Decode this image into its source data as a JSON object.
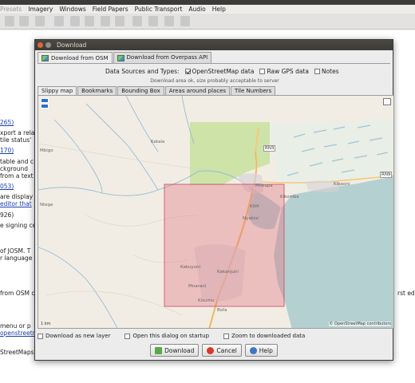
{
  "background": {
    "menu": [
      "Presets",
      "Imagery",
      "Windows",
      "Field Papers",
      "Public Transport",
      "Audio",
      "Help"
    ],
    "lines": [
      {
        "text": "265)",
        "link": true
      },
      {
        "text": "xport a rela",
        "link": false
      },
      {
        "text": " tile status'",
        "link": false
      },
      {
        "text": "170)",
        "link": true
      },
      {
        "text": "table and c",
        "link": false
      },
      {
        "text": "ckground",
        "link": false
      },
      {
        "text": "from a text",
        "link": false
      },
      {
        "text": "053)",
        "link": true
      },
      {
        "text": " are display",
        "link": false
      },
      {
        "text": "editor that",
        "link": true
      },
      {
        "text": "926)",
        "link": false
      },
      {
        "text": "e signing ce",
        "link": false
      },
      {
        "text": " of JOSM. T",
        "link": false
      },
      {
        "text": "r language",
        "link": false
      },
      {
        "text": "from OSM c",
        "link": false
      },
      {
        "text": " menu or p",
        "link": false
      },
      {
        "text": "openstreetr",
        "link": true
      },
      {
        "text": "StreetMaps",
        "link": false
      }
    ],
    "right_text": "rst edi"
  },
  "dialog": {
    "title": "Download",
    "source_tabs": [
      "Download from OSM",
      "Download from Overpass API"
    ],
    "data_sources_label": "Data Sources and Types:",
    "data_sources": [
      {
        "label": "OpenStreetMap data",
        "checked": true
      },
      {
        "label": "Raw GPS data",
        "checked": false
      },
      {
        "label": "Notes",
        "checked": false
      }
    ],
    "area_hint": "Download area ok, size probably acceptable to server",
    "area_tabs": [
      "Slippy map",
      "Bookmarks",
      "Bounding Box",
      "Areas around places",
      "Tile Numbers"
    ],
    "map": {
      "labels": {
        "mbigo": "Mbigo",
        "katala": "Katala",
        "rn3": "RN3",
        "rn9": "RN9",
        "mtwapa": "Mtwapa",
        "ntege": "Ntege",
        "kilifi": "Kilifi",
        "nyakisi": "Nyakisi",
        "kikombe": "Kikombe",
        "kibaoni": "Kibaoni",
        "kakuyuni": "Kakuyuni",
        "kakanjuni": "Kakanjuni",
        "mnarani": "Mnarani",
        "kisumu": "Kisumu",
        "bofa": "Bofa"
      },
      "attribution": "© OpenStreetMap contributors",
      "scale": "1 km"
    },
    "options": [
      {
        "label": "Download as new layer",
        "checked": false
      },
      {
        "label": "Open this dialog on startup",
        "checked": false
      },
      {
        "label": "Zoom to downloaded data",
        "checked": false
      }
    ],
    "buttons": {
      "download": "Download",
      "cancel": "Cancel",
      "help": "Help"
    },
    "colors": {
      "sea": "#b5d0d0",
      "land": "#f1ede4",
      "forest": "#cde3a8",
      "selection": "#e26b7c",
      "road_major": "#f6c87e"
    }
  }
}
